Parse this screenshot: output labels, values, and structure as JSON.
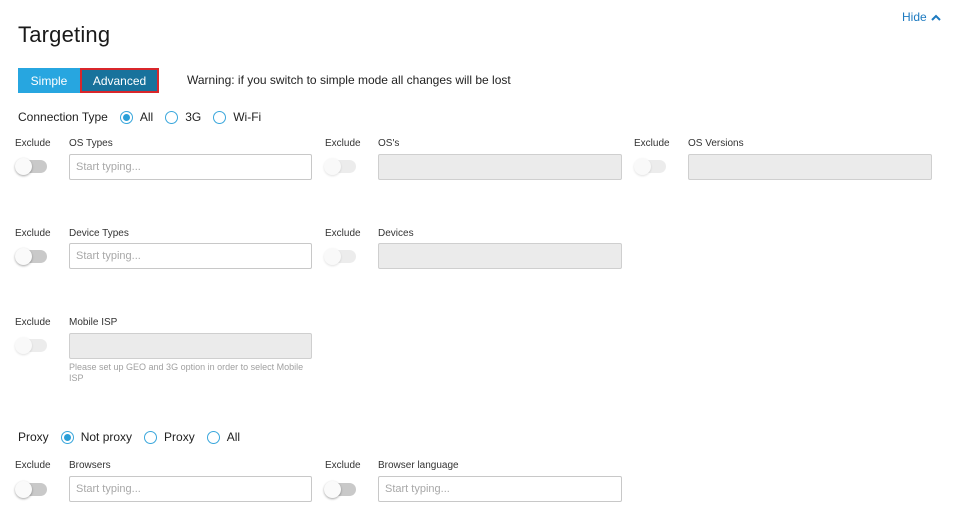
{
  "header": {
    "hide_label": "Hide",
    "title": "Targeting"
  },
  "mode": {
    "simple_label": "Simple",
    "advanced_label": "Advanced",
    "selected": "Advanced",
    "warning": "Warning: if you switch to simple mode all changes will be lost"
  },
  "connection_type": {
    "label": "Connection Type",
    "options": [
      "All",
      "3G",
      "Wi-Fi"
    ],
    "selected": "All"
  },
  "exclude_label": "Exclude",
  "fields": {
    "os_types": {
      "label": "OS Types",
      "placeholder": "Start typing..."
    },
    "oss": {
      "label": "OS's"
    },
    "os_versions": {
      "label": "OS Versions"
    },
    "device_types": {
      "label": "Device Types",
      "placeholder": "Start typing..."
    },
    "devices": {
      "label": "Devices"
    },
    "mobile_isp": {
      "label": "Mobile ISP",
      "helper": "Please set up GEO and 3G option in order to select Mobile ISP"
    },
    "browsers": {
      "label": "Browsers",
      "placeholder": "Start typing..."
    },
    "browser_language": {
      "label": "Browser language",
      "placeholder": "Start typing..."
    }
  },
  "proxy": {
    "label": "Proxy",
    "options": [
      "Not proxy",
      "Proxy",
      "All"
    ],
    "selected": "Not proxy"
  },
  "colors": {
    "accent": "#27a6e0",
    "accent_dark": "#18729c",
    "highlight_border": "#d9262b",
    "link": "#1d7ac0"
  },
  "icons": {
    "hide": "chevron-up-icon"
  }
}
